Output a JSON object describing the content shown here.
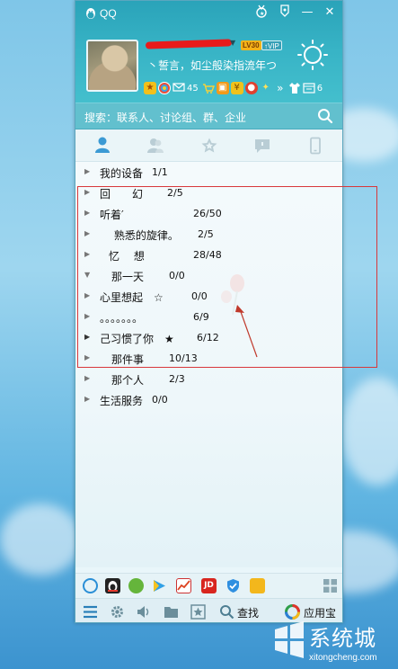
{
  "window": {
    "title": "QQ",
    "level_badge": "LV30",
    "vip_badge": "VIP",
    "signature": "丶誓言，如尘般染指流年つ",
    "mail_count": "45",
    "level_count": "6"
  },
  "search": {
    "label": "搜索：联系人、讨论组、群、企业"
  },
  "tabs": [
    {
      "name": "contacts",
      "icon": "person-icon"
    },
    {
      "name": "groups",
      "icon": "people-icon"
    },
    {
      "name": "favorites",
      "icon": "star-icon"
    },
    {
      "name": "messages",
      "icon": "chat-icon"
    },
    {
      "name": "device",
      "icon": "phone-icon"
    }
  ],
  "groups": [
    {
      "name": "我的设备",
      "count": "1/1"
    },
    {
      "name": "回　　幻",
      "count": "2/5"
    },
    {
      "name": "听着′",
      "count": "26/50"
    },
    {
      "name": "　 熟悉的旋律。",
      "count": "2/5"
    },
    {
      "name": "忆　 想",
      "count": "28/48"
    },
    {
      "name": "那一天",
      "count": "0/0"
    },
    {
      "name": "心里想起　☆",
      "count": "0/0"
    },
    {
      "name": "。。。。。。。",
      "count": "6/9"
    },
    {
      "name": "己习惯了你　★",
      "count": "6/12"
    },
    {
      "name": "那件事",
      "count": "10/13"
    },
    {
      "name": "那个人",
      "count": "2/3"
    },
    {
      "name": "生活服务",
      "count": "0/0"
    }
  ],
  "bottom": {
    "search_label": "查找",
    "appstore_label": "应用宝"
  },
  "watermark": {
    "name": "系统城",
    "url": "xitongcheng.com"
  }
}
